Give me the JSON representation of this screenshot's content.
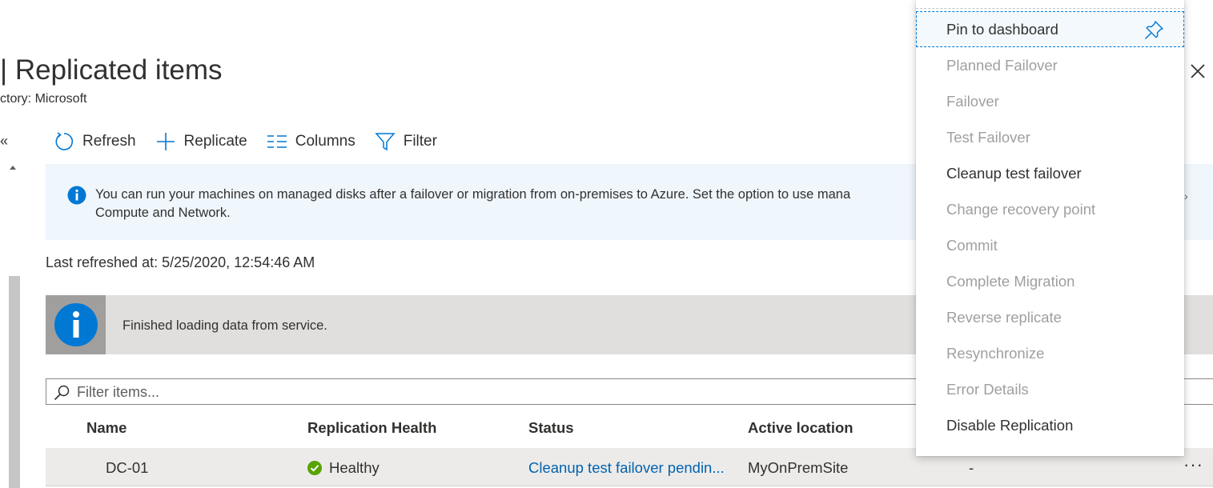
{
  "header": {
    "title": "| Replicated items",
    "subtitle": "ctory: Microsoft"
  },
  "nav": {
    "collapse_glyph": "«"
  },
  "toolbar": {
    "refresh": "Refresh",
    "replicate": "Replicate",
    "columns": "Columns",
    "filter": "Filter"
  },
  "info_banner": {
    "text": "You can run your machines on managed disks after a failover or migration from on-premises to Azure. Set the option to use mana",
    "text2": "Compute and Network.",
    "chevron": "›"
  },
  "last_refreshed": "Last refreshed at: 5/25/2020, 12:54:46 AM",
  "notice": {
    "text": "Finished loading data from service."
  },
  "filter": {
    "placeholder": "Filter items..."
  },
  "table": {
    "columns": [
      "Name",
      "Replication Health",
      "Status",
      "Active location"
    ],
    "rows": [
      {
        "name": "DC-01",
        "health": "Healthy",
        "status": "Cleanup test failover pendin...",
        "location": "MyOnPremSite",
        "extra": "-",
        "more": "···"
      }
    ]
  },
  "context_menu": {
    "items": [
      {
        "label": "Pin to dashboard",
        "enabled": true
      },
      {
        "label": "Planned Failover",
        "enabled": false
      },
      {
        "label": "Failover",
        "enabled": false
      },
      {
        "label": "Test Failover",
        "enabled": false
      },
      {
        "label": "Cleanup test failover",
        "enabled": true
      },
      {
        "label": "Change recovery point",
        "enabled": false
      },
      {
        "label": "Commit",
        "enabled": false
      },
      {
        "label": "Complete Migration",
        "enabled": false
      },
      {
        "label": "Reverse replicate",
        "enabled": false
      },
      {
        "label": "Resynchronize",
        "enabled": false
      },
      {
        "label": "Error Details",
        "enabled": false
      },
      {
        "label": "Disable Replication",
        "enabled": true
      }
    ]
  },
  "colors": {
    "accent": "#0078d4",
    "link": "#0063b1",
    "success": "#107c10",
    "info_bg": "#eff6fc",
    "disabled_text": "#a19f9d"
  }
}
